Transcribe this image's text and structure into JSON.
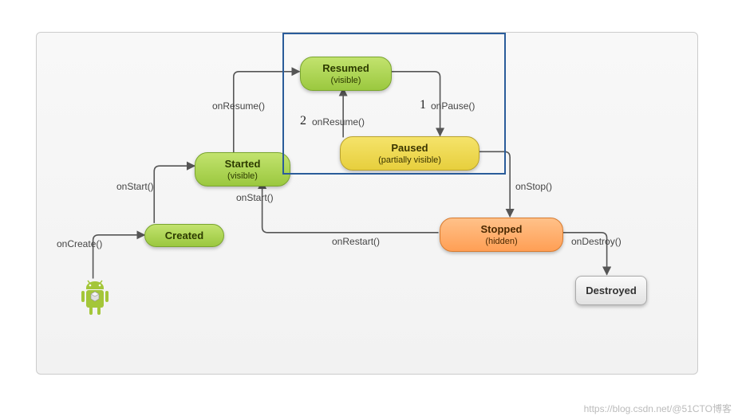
{
  "nodes": {
    "created": {
      "title": "Created",
      "sub": ""
    },
    "started": {
      "title": "Started",
      "sub": "(visible)"
    },
    "resumed": {
      "title": "Resumed",
      "sub": "(visible)"
    },
    "paused": {
      "title": "Paused",
      "sub": "(partially visible)"
    },
    "stopped": {
      "title": "Stopped",
      "sub": "(hidden)"
    },
    "destroyed": {
      "title": "Destroyed",
      "sub": ""
    }
  },
  "edges": {
    "onCreate": "onCreate()",
    "onStart": "onStart()",
    "onResume": "onResume()",
    "onResume2": "onResume()",
    "onPause": "onPause()",
    "onStop": "onStop()",
    "onRestart": "onRestart()",
    "onDestroy": "onDestroy()",
    "onStart2": "onStart()"
  },
  "annotations": {
    "a1": "1",
    "a2": "2"
  },
  "watermark_left": "https://blog.csdn.net/",
  "watermark_right": "@51CTO博客",
  "chart_data": {
    "type": "state_diagram",
    "title": "Android Activity Lifecycle",
    "states": [
      {
        "id": "created",
        "label": "Created",
        "note": ""
      },
      {
        "id": "started",
        "label": "Started",
        "note": "visible"
      },
      {
        "id": "resumed",
        "label": "Resumed",
        "note": "visible"
      },
      {
        "id": "paused",
        "label": "Paused",
        "note": "partially visible"
      },
      {
        "id": "stopped",
        "label": "Stopped",
        "note": "hidden"
      },
      {
        "id": "destroyed",
        "label": "Destroyed",
        "note": ""
      }
    ],
    "transitions": [
      {
        "from": "entry",
        "to": "created",
        "label": "onCreate()"
      },
      {
        "from": "created",
        "to": "started",
        "label": "onStart()"
      },
      {
        "from": "started",
        "to": "resumed",
        "label": "onResume()"
      },
      {
        "from": "resumed",
        "to": "paused",
        "label": "onPause()",
        "annotation": "1"
      },
      {
        "from": "paused",
        "to": "resumed",
        "label": "onResume()",
        "annotation": "2"
      },
      {
        "from": "paused",
        "to": "stopped",
        "label": "onStop()"
      },
      {
        "from": "stopped",
        "to": "started",
        "label": "onRestart()",
        "via": "onStart()"
      },
      {
        "from": "stopped",
        "to": "destroyed",
        "label": "onDestroy()"
      }
    ],
    "highlight_region": [
      "resumed",
      "paused"
    ]
  }
}
